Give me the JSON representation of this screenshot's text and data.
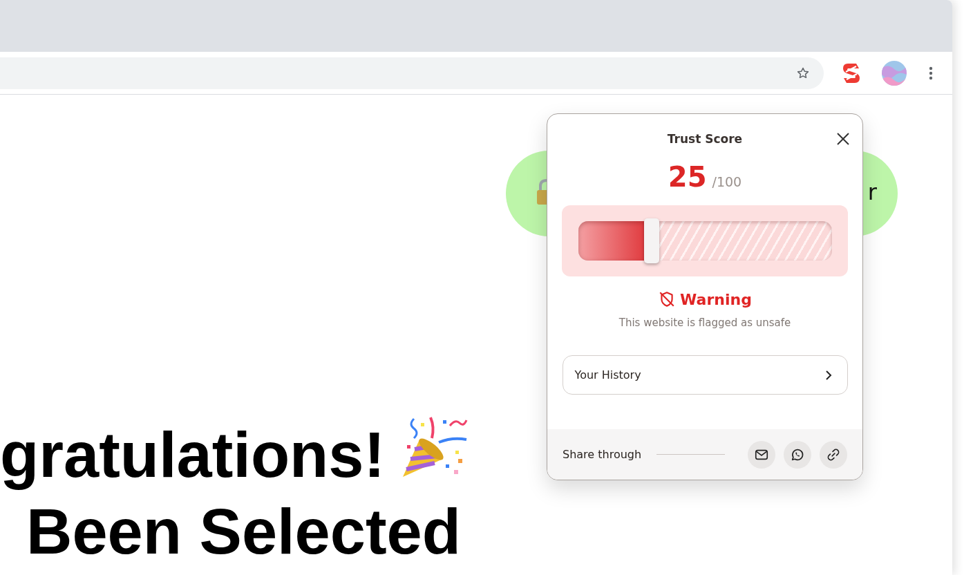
{
  "page": {
    "banner": {
      "text": "r"
    },
    "heading": {
      "lines": [
        "gratulations!",
        "Been Selected"
      ]
    }
  },
  "popup": {
    "title": "Trust Score",
    "score": "25",
    "score_max": "/100",
    "meter": {
      "level": 0.27
    },
    "status": {
      "title": "Warning",
      "message": "This website is flagged as unsafe"
    },
    "history_button": {
      "label": "Your History"
    },
    "share": {
      "label": "Share through",
      "buttons": [
        {
          "kind": "email"
        },
        {
          "kind": "whatsapp"
        },
        {
          "kind": "link"
        }
      ]
    }
  }
}
